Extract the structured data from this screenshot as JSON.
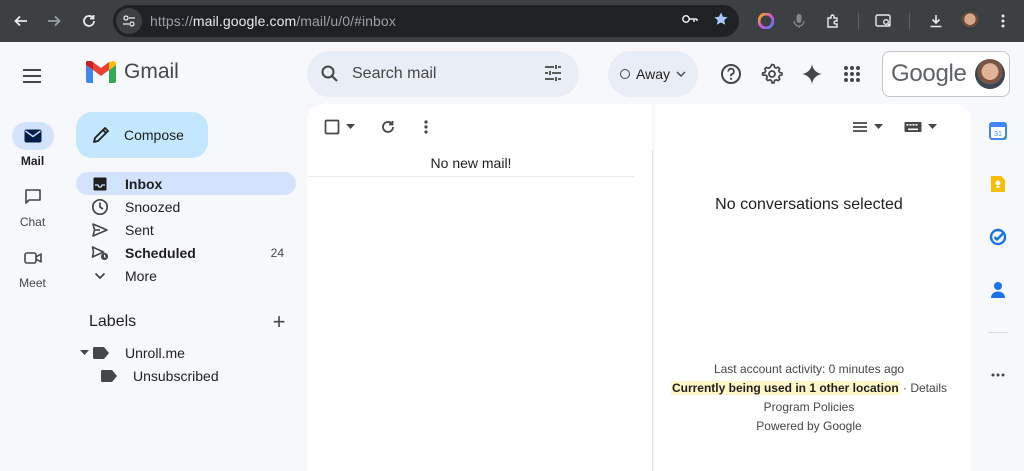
{
  "browser": {
    "url_prefix": "https://",
    "url_host": "mail.google.com",
    "url_path": "/mail/u/0/#inbox"
  },
  "rail": {
    "items": [
      {
        "label": "Mail",
        "icon": "mail-icon",
        "active": true
      },
      {
        "label": "Chat",
        "icon": "chat-icon",
        "active": false
      },
      {
        "label": "Meet",
        "icon": "meet-icon",
        "active": false
      }
    ]
  },
  "header": {
    "app_name": "Gmail",
    "search_placeholder": "Search mail",
    "status_label": "Away",
    "account_brand": "Google"
  },
  "compose_label": "Compose",
  "nav": [
    {
      "label": "Inbox",
      "icon": "inbox-icon",
      "active": true,
      "count": ""
    },
    {
      "label": "Snoozed",
      "icon": "clock-icon",
      "active": false,
      "count": ""
    },
    {
      "label": "Sent",
      "icon": "send-icon",
      "active": false,
      "count": ""
    },
    {
      "label": "Scheduled",
      "icon": "scheduled-icon",
      "active": false,
      "count": "24"
    },
    {
      "label": "More",
      "icon": "chevron-down-icon",
      "active": false,
      "count": ""
    }
  ],
  "labels": {
    "heading": "Labels",
    "items": [
      {
        "name": "Unroll.me"
      },
      {
        "name": "Unsubscribed"
      }
    ]
  },
  "list": {
    "empty_message": "No new mail!"
  },
  "reading_pane": {
    "empty_message": "No conversations selected",
    "last_activity": "Last account activity: 0 minutes ago",
    "other_location": "Currently being used in 1 other location",
    "details_sep": " · ",
    "details_link": "Details",
    "policies": "Program Policies",
    "powered_by": "Powered by Google"
  },
  "colors": {
    "accent": "#0b57d0",
    "compose_bg": "#c2e7ff",
    "active_nav": "#d3e3fd",
    "highlight": "#fef7c7"
  }
}
